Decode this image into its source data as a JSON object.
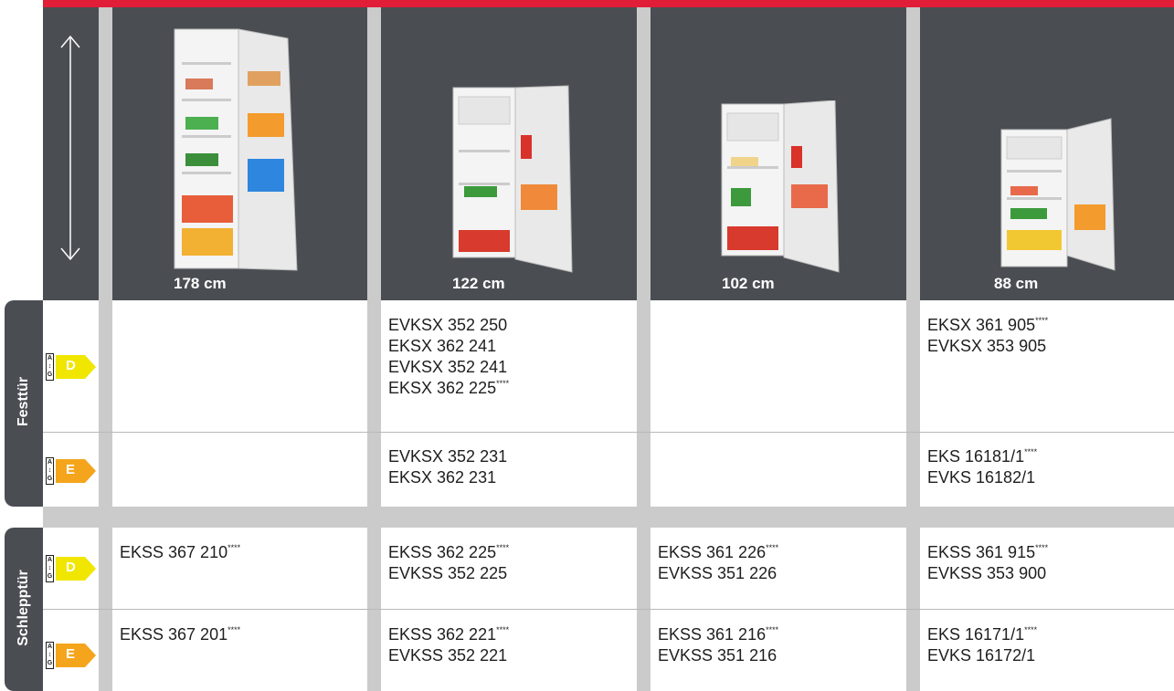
{
  "columns": [
    {
      "height": "178 cm"
    },
    {
      "height": "122 cm"
    },
    {
      "height": "102 cm"
    },
    {
      "height": "88 cm"
    }
  ],
  "groups": {
    "festtuer": {
      "label": "Festtür",
      "rows": [
        {
          "energy_class": "D",
          "energy_scale": [
            "A",
            "G"
          ],
          "cells": [
            [],
            [
              {
                "model": "EVKSX 352 250",
                "mark": ""
              },
              {
                "model": "EKSX 362 241",
                "mark": ""
              },
              {
                "model": "EVKSX 352 241",
                "mark": ""
              },
              {
                "model": "EKSX 362 225",
                "mark": "****"
              }
            ],
            [],
            [
              {
                "model": "EKSX 361 905",
                "mark": "****"
              },
              {
                "model": "EVKSX 353 905",
                "mark": ""
              }
            ]
          ]
        },
        {
          "energy_class": "E",
          "energy_scale": [
            "A",
            "G"
          ],
          "cells": [
            [],
            [
              {
                "model": "EVKSX 352 231",
                "mark": ""
              },
              {
                "model": "EKSX 362 231",
                "mark": ""
              }
            ],
            [],
            [
              {
                "model": "EKS 16181/1",
                "mark": "****"
              },
              {
                "model": "EVKS 16182/1",
                "mark": ""
              }
            ]
          ]
        }
      ]
    },
    "schlepptuer": {
      "label": "Schlepptür",
      "rows": [
        {
          "energy_class": "D",
          "energy_scale": [
            "A",
            "G"
          ],
          "cells": [
            [
              {
                "model": "EKSS 367 210",
                "mark": "****"
              }
            ],
            [
              {
                "model": "EKSS 362 225",
                "mark": "****"
              },
              {
                "model": "EVKSS 352 225",
                "mark": ""
              }
            ],
            [
              {
                "model": "EKSS 361 226",
                "mark": "****"
              },
              {
                "model": "EVKSS 351 226",
                "mark": ""
              }
            ],
            [
              {
                "model": "EKSS 361 915",
                "mark": "****"
              },
              {
                "model": "EVKSS 353 900",
                "mark": ""
              }
            ]
          ]
        },
        {
          "energy_class": "E",
          "energy_scale": [
            "A",
            "G"
          ],
          "cells": [
            [
              {
                "model": "EKSS 367 201",
                "mark": "****"
              }
            ],
            [
              {
                "model": "EKSS 362 221",
                "mark": "****"
              },
              {
                "model": "EVKSS 352 221",
                "mark": ""
              }
            ],
            [
              {
                "model": "EKSS 361 216",
                "mark": "****"
              },
              {
                "model": "EVKSS 351 216",
                "mark": ""
              }
            ],
            [
              {
                "model": "EKS 16171/1",
                "mark": "****"
              },
              {
                "model": "EVKS 16172/1",
                "mark": ""
              }
            ]
          ]
        }
      ]
    }
  },
  "icons": {
    "height_arrow": "double-arrow-vertical-icon",
    "fridge_image": "built-in-fridge-open-image"
  },
  "colors": {
    "accent_red": "#e11d37",
    "header_dark": "#4a4e53",
    "energy_D": "#f0e600",
    "energy_E": "#f4a51c",
    "separator_gray": "#cbcbcb"
  }
}
